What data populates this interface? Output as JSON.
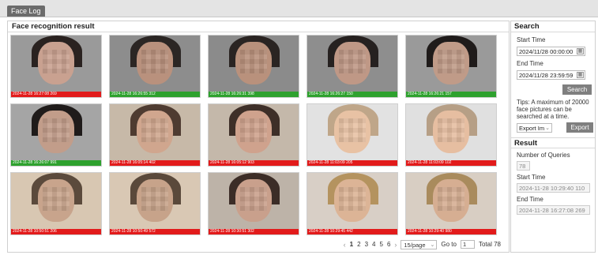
{
  "tab": {
    "label": "Face Log"
  },
  "main": {
    "title": "Face recognition result"
  },
  "results": [
    {
      "caption": "2024-11-28 16:27:08 269",
      "status": "red",
      "bg": "#9a9a9a",
      "skin": "#c9a190",
      "hair": "#2a2220"
    },
    {
      "caption": "2024-11-28 16:26:55 312",
      "status": "green",
      "bg": "#8d8d8d",
      "skin": "#b9917d",
      "hair": "#2b2624"
    },
    {
      "caption": "2024-11-28 16:26:31 398",
      "status": "green",
      "bg": "#8b8b8b",
      "skin": "#b9917c",
      "hair": "#2a2422"
    },
    {
      "caption": "2024-11-28 16:26:27 150",
      "status": "green",
      "bg": "#8e8e8e",
      "skin": "#bf9886",
      "hair": "#262120"
    },
    {
      "caption": "2024-11-28 16:26:21 157",
      "status": "green",
      "bg": "#9a9a9a",
      "skin": "#c09b88",
      "hair": "#1f1b1a"
    },
    {
      "caption": "2024-11-28 16:26:07 991",
      "status": "green",
      "bg": "#a5a5a5",
      "skin": "#c29d8a",
      "hair": "#1f1b1a"
    },
    {
      "caption": "2024-11-28 16:05:14 402",
      "status": "red",
      "bg": "#c7b9a8",
      "skin": "#d0a68e",
      "hair": "#4e3b31"
    },
    {
      "caption": "2024-11-28 16:05:12 903",
      "status": "red",
      "bg": "#c4b8aa",
      "skin": "#cfa28d",
      "hair": "#3e2f28"
    },
    {
      "caption": "2024-11-28 11:03:09 205",
      "status": "red",
      "bg": "#e2e2e2",
      "skin": "#e8c2a4",
      "hair": "#bfa689"
    },
    {
      "caption": "2024-11-28 11:03:09 102",
      "status": "red",
      "bg": "#e0e0e0",
      "skin": "#e6bea1",
      "hair": "#b69f86"
    },
    {
      "caption": "2024-11-28 10:50:51 206",
      "status": "red",
      "bg": "#d8c7b2",
      "skin": "#c8a48c",
      "hair": "#5b4a3c"
    },
    {
      "caption": "2024-11-28 10:50:49 572",
      "status": "red",
      "bg": "#d9c8b4",
      "skin": "#c7a38a",
      "hair": "#5a493b"
    },
    {
      "caption": "2024-11-28 10:30:51 302",
      "status": "red",
      "bg": "#bdb3a8",
      "skin": "#c9a08c",
      "hair": "#3c2d27"
    },
    {
      "caption": "2024-11-28 10:29:45 442",
      "status": "red",
      "bg": "#d8cfc6",
      "skin": "#dcb496",
      "hair": "#b4935f"
    },
    {
      "caption": "2024-11-28 10:29:40 980",
      "status": "red",
      "bg": "#d8cec3",
      "skin": "#d6ae92",
      "hair": "#a98b5d"
    }
  ],
  "pager": {
    "prev": "‹",
    "pages": [
      "1",
      "2",
      "3",
      "4",
      "5",
      "6"
    ],
    "next": "›",
    "per_page": "15/page",
    "goto_label": "Go to",
    "goto_value": "1",
    "total": "Total 78"
  },
  "search": {
    "title": "Search",
    "start_label": "Start Time",
    "start_value": "2024/11/28 00:00:00",
    "end_label": "End Time",
    "end_value": "2024/11/28 23:59:59",
    "search_btn": "Search",
    "tips": "Tips: A maximum of 20000 face pictures can be searched at a time.",
    "export_type": "Export Im",
    "export_btn": "Export"
  },
  "result": {
    "title": "Result",
    "queries_label": "Number of Queries",
    "queries_value": "78",
    "start_label": "Start Time",
    "start_value": "2024-11-28 10:29:40 110",
    "end_label": "End Time",
    "end_value": "2024-11-28 16:27:08 269"
  },
  "icons": {
    "calendar": "calendar-icon",
    "chevron": "chevron-down-icon"
  },
  "colors": {
    "caption_green": "#2ea12e",
    "caption_red": "#e21b1b",
    "button": "#7f7f7f"
  }
}
